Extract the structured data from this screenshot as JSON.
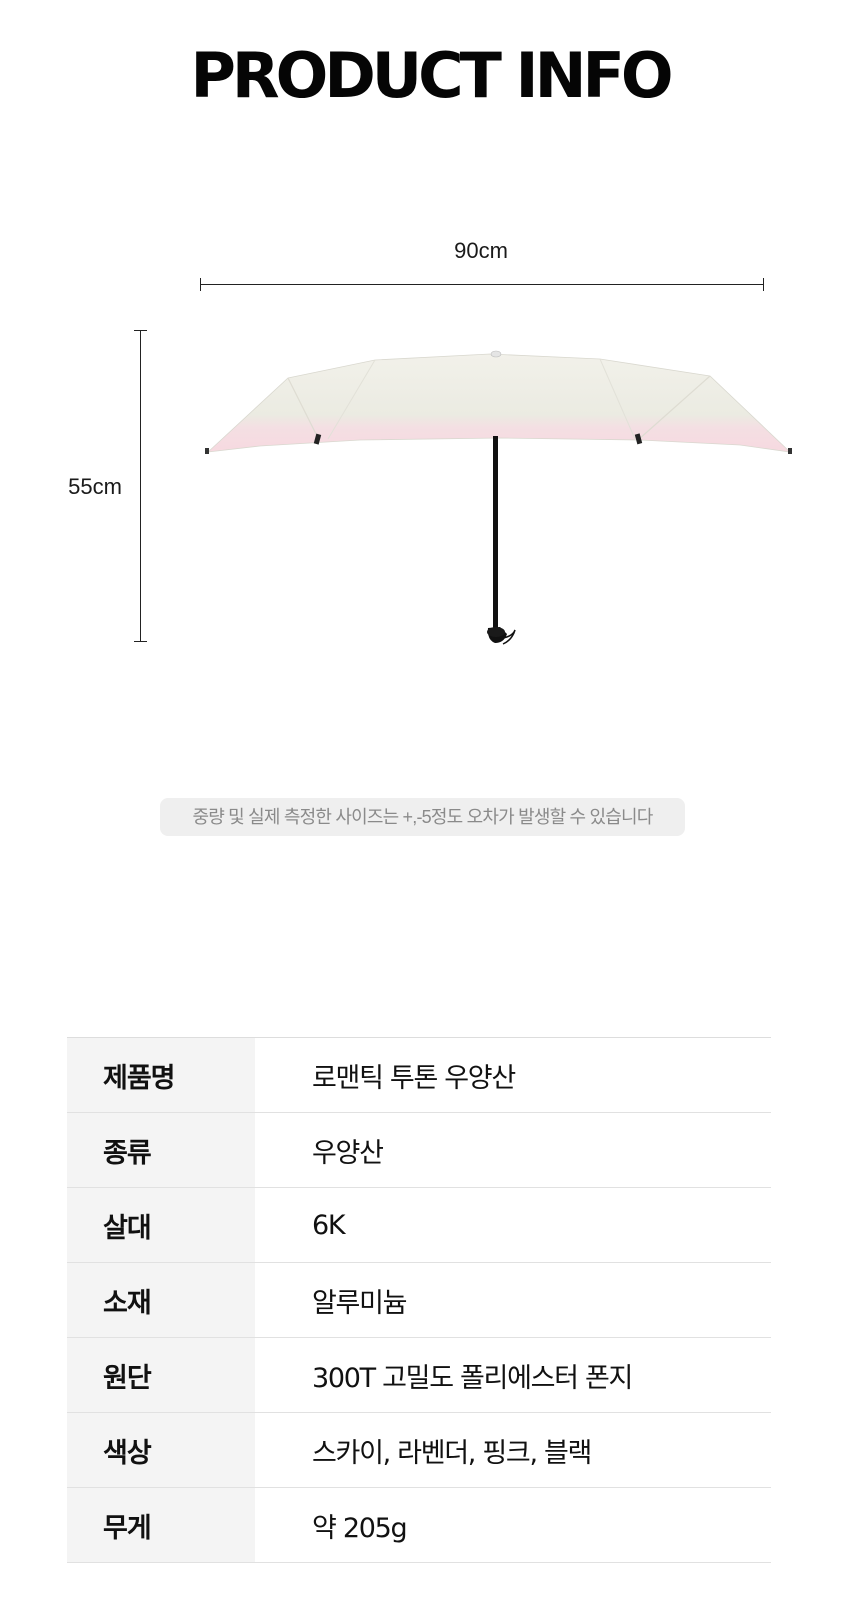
{
  "header": {
    "title": "PRODUCT INFO"
  },
  "dimensions": {
    "width_label": "90cm",
    "height_label": "55cm"
  },
  "product_image": {
    "canopy_color": "#eeede4",
    "trim_color": "#f6dde3",
    "shaft_color": "#111111"
  },
  "notice": {
    "text": "중량 및 실제 측정한 사이즈는 +,-5정도 오차가 발생할 수 있습니다"
  },
  "specs": [
    {
      "label": "제품명",
      "value": "로맨틱 투톤 우양산"
    },
    {
      "label": "종류",
      "value": "우양산"
    },
    {
      "label": "살대",
      "value": "6K"
    },
    {
      "label": "소재",
      "value": "알루미늄"
    },
    {
      "label": "원단",
      "value": "300T 고밀도 폴리에스터 폰지"
    },
    {
      "label": "색상",
      "value": "스카이, 라벤더, 핑크, 블랙"
    },
    {
      "label": "무게",
      "value": "약 205g"
    }
  ]
}
